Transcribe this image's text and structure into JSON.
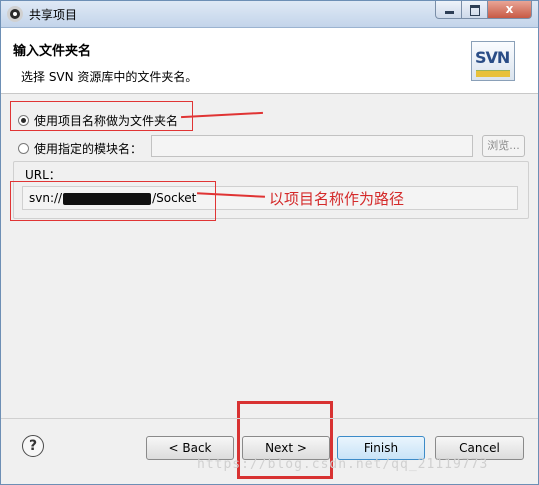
{
  "window": {
    "title": "共享项目",
    "close_symbol": "x"
  },
  "header": {
    "title": "输入文件夹名",
    "subtitle": "选择 SVN 资源库中的文件夹名。",
    "logo_text": "SVN"
  },
  "options": {
    "use_project_name": "使用项目名称做为文件夹名",
    "use_specified_module": "使用指定的模块名：",
    "module_value": "",
    "browse_label": "浏览..."
  },
  "url": {
    "label": "URL：",
    "prefix": "svn://",
    "suffix": "/Socket"
  },
  "annotation": {
    "text": "以项目名称作为路径",
    "color": "#e03434"
  },
  "buttons": {
    "help": "?",
    "back": "< Back",
    "next": "Next >",
    "finish": "Finish",
    "cancel": "Cancel"
  },
  "watermark": "https://blog.csdn.net/qq_21119773"
}
